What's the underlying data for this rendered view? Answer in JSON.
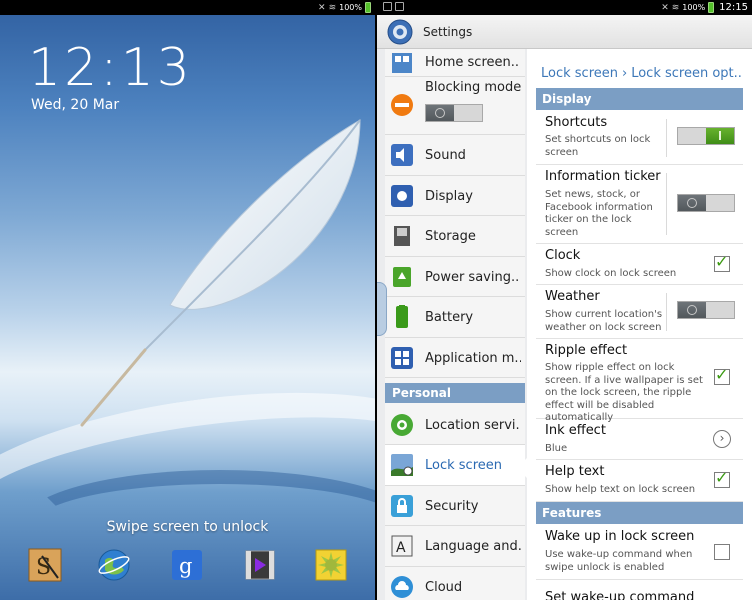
{
  "lock_screen": {
    "status": {
      "battery_percent": "100%"
    },
    "time": "12:13",
    "date": "Wed, 20 Mar",
    "swipe_hint": "Swipe screen to unlock",
    "dock": [
      {
        "icon": "s-note-icon"
      },
      {
        "icon": "browser-globe-icon"
      },
      {
        "icon": "google-search-icon"
      },
      {
        "icon": "video-player-icon"
      },
      {
        "icon": "gallery-icon"
      }
    ]
  },
  "settings": {
    "status": {
      "battery_percent": "100%",
      "time": "12:15"
    },
    "title": "Settings",
    "left_list": {
      "items": [
        {
          "label": "Home screen..",
          "icon": "home-screen-icon"
        },
        {
          "label": "Blocking mode",
          "icon": "blocking-mode-icon"
        },
        {
          "label": "Sound",
          "icon": "sound-icon"
        },
        {
          "label": "Display",
          "icon": "display-icon"
        },
        {
          "label": "Storage",
          "icon": "storage-icon"
        },
        {
          "label": "Power saving..",
          "icon": "power-saving-icon"
        },
        {
          "label": "Battery",
          "icon": "battery-icon"
        },
        {
          "label": "Application m..",
          "icon": "application-manager-icon"
        }
      ],
      "section_personal": "Personal",
      "personal_items": [
        {
          "label": "Location servi..",
          "icon": "location-icon"
        },
        {
          "label": "Lock screen",
          "icon": "lock-screen-icon",
          "active": true
        },
        {
          "label": "Security",
          "icon": "security-icon"
        },
        {
          "label": "Language and..",
          "icon": "language-icon"
        },
        {
          "label": "Cloud",
          "icon": "cloud-icon"
        }
      ]
    },
    "detail": {
      "breadcrumb": [
        "Lock screen",
        "Lock screen opt.."
      ],
      "section_display": "Display",
      "rows": [
        {
          "title": "Shortcuts",
          "subtitle": "Set shortcuts on lock screen",
          "control": "toggle",
          "on": true
        },
        {
          "title": "Information ticker",
          "subtitle": "Set news, stock, or Facebook information ticker on the lock screen",
          "control": "toggle",
          "on": false
        },
        {
          "title": "Clock",
          "subtitle": "Show clock on lock screen",
          "control": "checkbox",
          "on": true
        },
        {
          "title": "Weather",
          "subtitle": "Show current location's weather on lock screen",
          "control": "toggle",
          "on": false
        },
        {
          "title": "Ripple effect",
          "subtitle": "Show ripple effect on lock screen. If a live wallpaper is set on the lock screen, the ripple effect will be disabled automatically",
          "control": "checkbox",
          "on": true
        },
        {
          "title": "Ink effect",
          "subtitle": "Blue",
          "control": "chevron"
        },
        {
          "title": "Help text",
          "subtitle": "Show help text on lock screen",
          "control": "checkbox",
          "on": true
        }
      ],
      "section_features": "Features",
      "feature_rows": [
        {
          "title": "Wake up in lock screen",
          "subtitle": "Use wake-up command when swipe unlock is enabled",
          "control": "checkbox",
          "on": false
        },
        {
          "title": "Set wake-up command"
        }
      ]
    }
  }
}
